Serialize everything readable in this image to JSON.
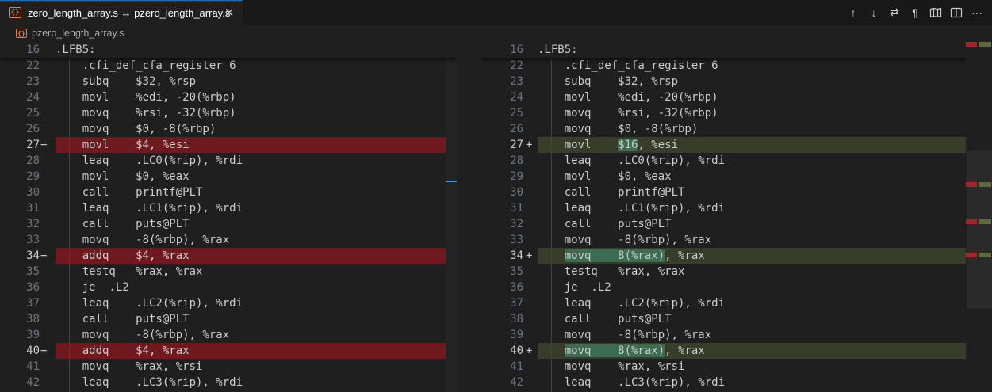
{
  "tab": {
    "title": "zero_length_array.s ↔ pzero_length_array.s",
    "file_icon": "{}",
    "close_glyph": "✕"
  },
  "actions": [
    {
      "name": "previous-change-icon",
      "glyph": "↑"
    },
    {
      "name": "next-change-icon",
      "glyph": "↓"
    },
    {
      "name": "swap-sides-icon",
      "glyph": "⇄"
    },
    {
      "name": "show-whitespace-icon",
      "glyph": "¶"
    },
    {
      "name": "open-file-icon",
      "glyph": "🕮"
    },
    {
      "name": "split-editor-icon",
      "glyph": "◫"
    },
    {
      "name": "more-actions-icon",
      "glyph": "···"
    }
  ],
  "breadcrumb": {
    "file": "pzero_length_array.s",
    "file_icon": "{}"
  },
  "colors": {
    "deleted_line": "#6e1a1e",
    "inserted_line": "#373d29",
    "inserted_text": "#3c6d52",
    "accent": "#0078d4"
  },
  "left": {
    "sticky": {
      "num": "16",
      "code": ".LFB5:"
    },
    "lines": [
      {
        "num": "22",
        "code": "    .cfi_def_cfa_register 6"
      },
      {
        "num": "23",
        "code": "    subq    $32, %rsp"
      },
      {
        "num": "24",
        "code": "    movl    %edi, -20(%rbp)"
      },
      {
        "num": "25",
        "code": "    movq    %rsi, -32(%rbp)"
      },
      {
        "num": "26",
        "code": "    movq    $0, -8(%rbp)"
      },
      {
        "num": "27",
        "code": "    movl    $4, %esi",
        "type": "del"
      },
      {
        "num": "28",
        "code": "    leaq    .LC0(%rip), %rdi"
      },
      {
        "num": "29",
        "code": "    movl    $0, %eax"
      },
      {
        "num": "30",
        "code": "    call    printf@PLT"
      },
      {
        "num": "31",
        "code": "    leaq    .LC1(%rip), %rdi"
      },
      {
        "num": "32",
        "code": "    call    puts@PLT"
      },
      {
        "num": "33",
        "code": "    movq    -8(%rbp), %rax"
      },
      {
        "num": "34",
        "code": "    addq    $4, %rax",
        "type": "del"
      },
      {
        "num": "35",
        "code": "    testq   %rax, %rax"
      },
      {
        "num": "36",
        "code": "    je  .L2"
      },
      {
        "num": "37",
        "code": "    leaq    .LC2(%rip), %rdi"
      },
      {
        "num": "38",
        "code": "    call    puts@PLT"
      },
      {
        "num": "39",
        "code": "    movq    -8(%rbp), %rax"
      },
      {
        "num": "40",
        "code": "    addq    $4, %rax",
        "type": "del"
      },
      {
        "num": "41",
        "code": "    movq    %rax, %rsi"
      },
      {
        "num": "42",
        "code": "    leaq    .LC3(%rip), %rdi"
      }
    ]
  },
  "right": {
    "sticky": {
      "num": "16",
      "code": ".LFB5:"
    },
    "lines": [
      {
        "num": "22",
        "code": "    .cfi_def_cfa_register 6"
      },
      {
        "num": "23",
        "code": "    subq    $32, %rsp"
      },
      {
        "num": "24",
        "code": "    movl    %edi, -20(%rbp)"
      },
      {
        "num": "25",
        "code": "    movq    %rsi, -32(%rbp)"
      },
      {
        "num": "26",
        "code": "    movq    $0, -8(%rbp)"
      },
      {
        "num": "27",
        "code": "    movl    $16, %esi",
        "type": "ins",
        "hl": "$16"
      },
      {
        "num": "28",
        "code": "    leaq    .LC0(%rip), %rdi"
      },
      {
        "num": "29",
        "code": "    movl    $0, %eax"
      },
      {
        "num": "30",
        "code": "    call    printf@PLT"
      },
      {
        "num": "31",
        "code": "    leaq    .LC1(%rip), %rdi"
      },
      {
        "num": "32",
        "code": "    call    puts@PLT"
      },
      {
        "num": "33",
        "code": "    movq    -8(%rbp), %rax"
      },
      {
        "num": "34",
        "code": "    movq    8(%rax), %rax",
        "type": "ins",
        "hl": "movq    8(%rax)"
      },
      {
        "num": "35",
        "code": "    testq   %rax, %rax"
      },
      {
        "num": "36",
        "code": "    je  .L2"
      },
      {
        "num": "37",
        "code": "    leaq    .LC2(%rip), %rdi"
      },
      {
        "num": "38",
        "code": "    call    puts@PLT"
      },
      {
        "num": "39",
        "code": "    movq    -8(%rbp), %rax"
      },
      {
        "num": "40",
        "code": "    movq    8(%rax), %rax",
        "type": "ins",
        "hl": "movq    8(%rax)"
      },
      {
        "num": "41",
        "code": "    movq    %rax, %rsi"
      },
      {
        "num": "42",
        "code": "    leaq    .LC3(%rip), %rdi"
      }
    ]
  },
  "markers": {
    "del": "−",
    "ins": "+"
  }
}
